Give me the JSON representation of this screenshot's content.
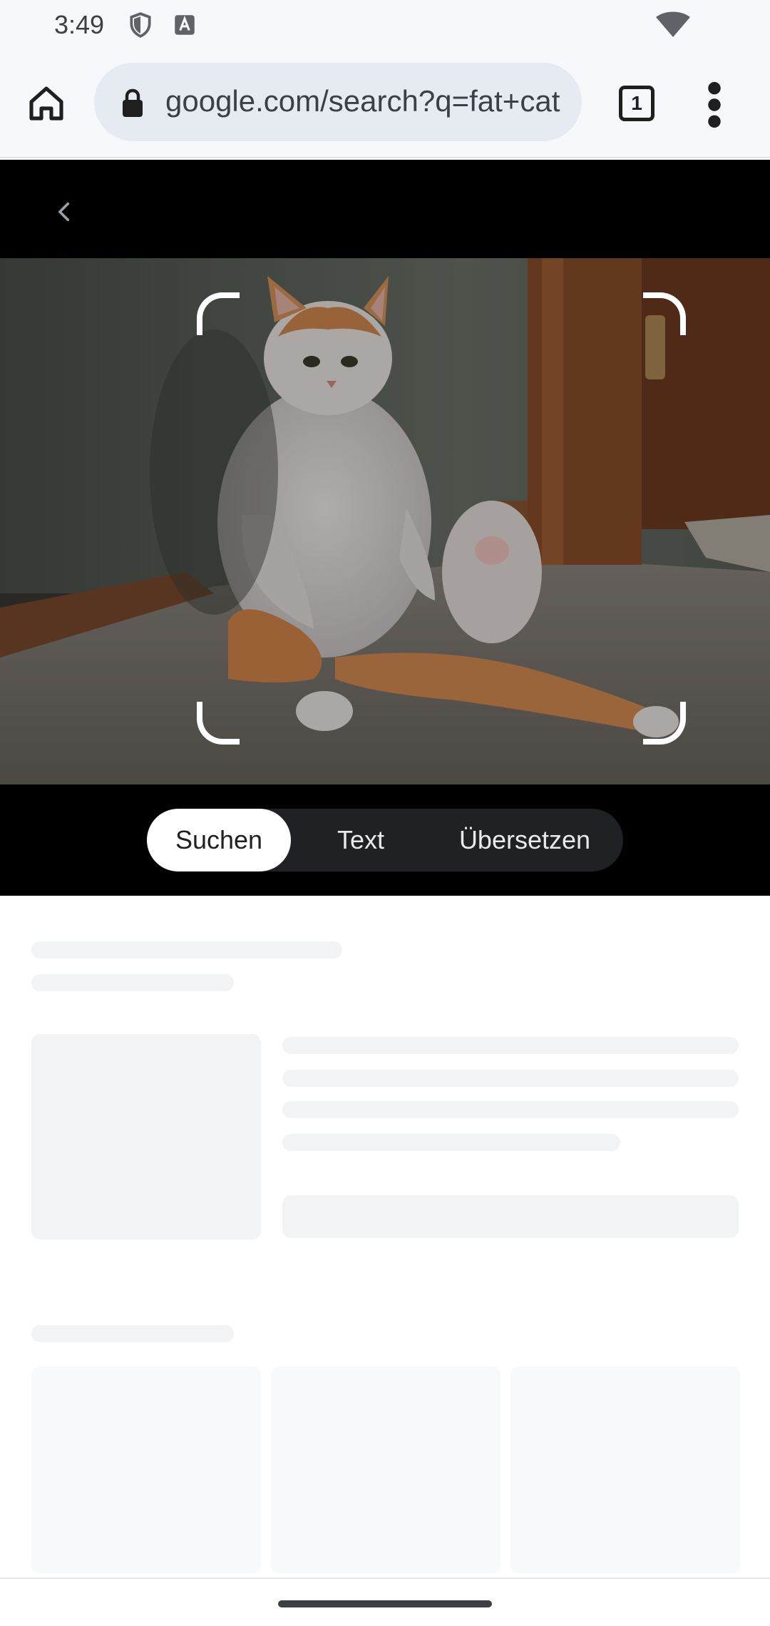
{
  "status_bar": {
    "time": "3:49",
    "icons": [
      "shield-icon",
      "text-a-icon",
      "wifi-icon"
    ]
  },
  "browser": {
    "url": "google.com/search?q=fat+cat",
    "tab_count": "1",
    "icons": [
      "home-icon",
      "lock-icon",
      "tabs-icon",
      "more-vert-icon"
    ]
  },
  "lens": {
    "back_icon": "chevron-left-icon",
    "modes": {
      "search": "Suchen",
      "text": "Text",
      "translate": "Übersetzen"
    },
    "selected_mode": "Suchen"
  },
  "colors": {
    "toolbar_bg": "#f7f8fb",
    "omnibox_bg": "#e6ebf2",
    "lens_bg": "#000000",
    "placeholder": "#f1f3f4"
  }
}
